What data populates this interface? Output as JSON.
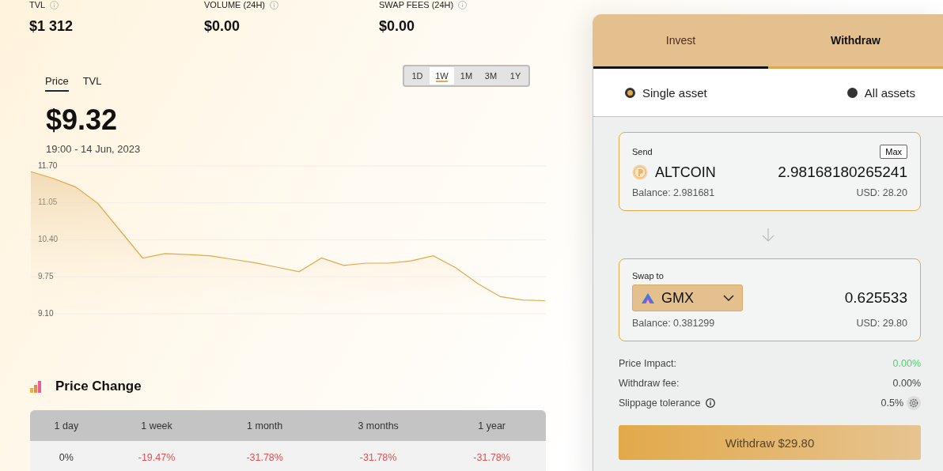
{
  "stats": [
    {
      "label": "TVL",
      "value": "$1 312"
    },
    {
      "label": "VOLUME (24H)",
      "value": "$0.00"
    },
    {
      "label": "SWAP FEES (24H)",
      "value": "$0.00"
    }
  ],
  "chart_tabs": [
    {
      "label": "Price",
      "selected": true
    },
    {
      "label": "TVL",
      "selected": false
    }
  ],
  "ranges": [
    {
      "label": "1D",
      "selected": false
    },
    {
      "label": "1W",
      "selected": true
    },
    {
      "label": "1M",
      "selected": false
    },
    {
      "label": "3M",
      "selected": false
    },
    {
      "label": "1Y",
      "selected": false
    }
  ],
  "price": "$9.32",
  "timestamp": "19:00 - 14 Jun, 2023",
  "chart": {
    "chart_data": {
      "type": "area",
      "grid": true,
      "ylim": [
        9.1,
        11.7
      ],
      "yticks": [
        {
          "value": 11.7,
          "label": "11.70"
        },
        {
          "value": 11.05,
          "label": "11.05"
        },
        {
          "value": 10.4,
          "label": "10.40"
        },
        {
          "value": 9.75,
          "label": "9.75"
        },
        {
          "value": 9.1,
          "label": "9.10"
        }
      ],
      "series": [
        {
          "color": "#e2a94a",
          "values": [
            11.6,
            11.48,
            11.33,
            11.04,
            10.56,
            10.08,
            10.16,
            10.14,
            10.12,
            10.06,
            10.0,
            9.92,
            9.84,
            10.08,
            9.95,
            9.99,
            9.99,
            10.03,
            10.12,
            9.91,
            9.63,
            9.4,
            9.34,
            9.33
          ]
        }
      ]
    }
  },
  "price_change": {
    "title": "Price Change",
    "columns": [
      "1 day",
      "1 week",
      "1 month",
      "3 months",
      "1 year"
    ],
    "values": [
      {
        "text": "0%",
        "color": "#333333"
      },
      {
        "text": "-19.47%",
        "color": "#e0504f"
      },
      {
        "text": "-31.78%",
        "color": "#e0504f"
      },
      {
        "text": "-31.78%",
        "color": "#e0504f"
      },
      {
        "text": "-31.78%",
        "color": "#e0504f"
      }
    ]
  },
  "panel": {
    "tabs": [
      {
        "label": "Invest",
        "selected": false
      },
      {
        "label": "Withdraw",
        "selected": true
      }
    ],
    "modes": [
      {
        "label": "Single asset",
        "selected": true
      },
      {
        "label": "All assets",
        "selected": false
      }
    ],
    "send": {
      "label": "Send",
      "max": "Max",
      "token": "ALTCOIN",
      "amount": "2.98168180265241",
      "balance": "Balance: 2.981681",
      "usd": "USD: 28.20"
    },
    "swap": {
      "label": "Swap to",
      "token": "GMX",
      "amount": "0.625533",
      "balance": "Balance: 0.381299",
      "usd": "USD: 29.80"
    },
    "details": [
      {
        "label": "Price Impact:",
        "value": "0.00%",
        "color": "#4ed36b",
        "kind": "plain"
      },
      {
        "label": "Withdraw fee:",
        "value": "0.00%",
        "color": "#444444",
        "kind": "plain"
      },
      {
        "label": "Slippage tolerance",
        "value": "0.5%",
        "color": "#444444",
        "kind": "setting"
      }
    ],
    "submit": "Withdraw $29.80"
  }
}
